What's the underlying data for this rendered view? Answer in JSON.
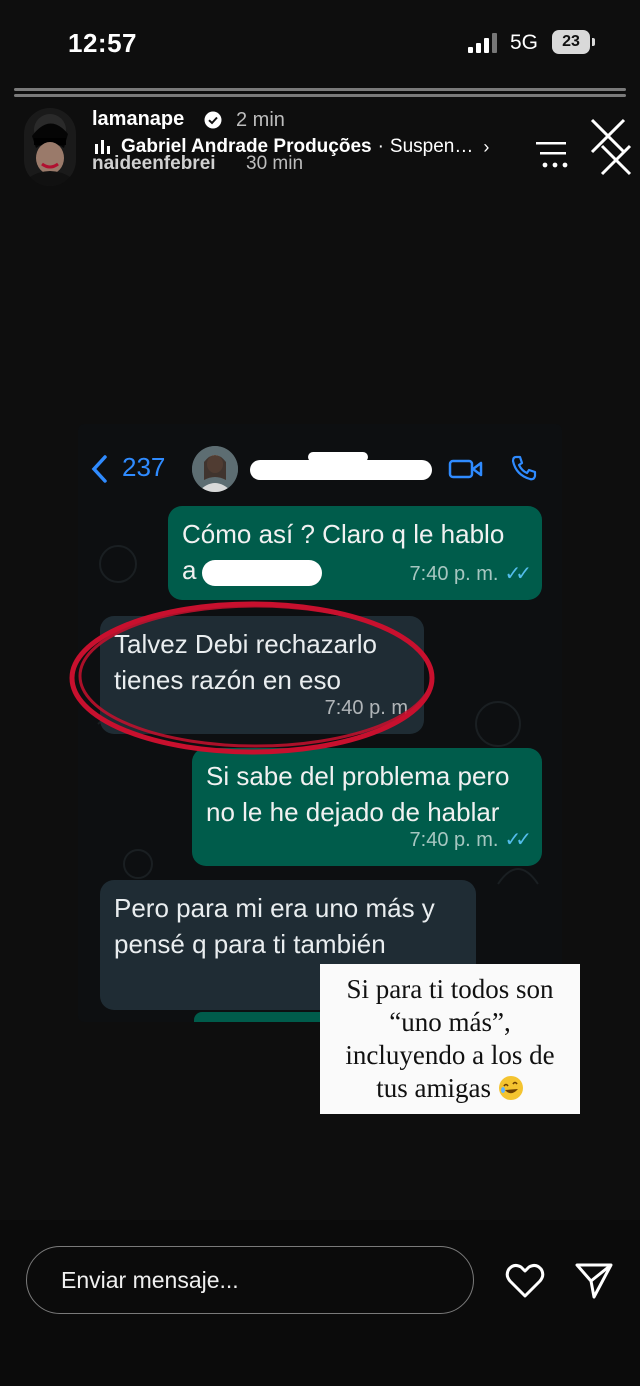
{
  "status_bar": {
    "time": "12:57",
    "network": "5G",
    "battery": "23"
  },
  "story_header": {
    "username": "lamanape",
    "time_ago": "2 min",
    "music": {
      "title": "Gabriel Andrade Produções",
      "separator": "·",
      "subtitle": "Suspen…",
      "chevron": "›"
    },
    "username_2": "naideenfebrei",
    "time_ago_2": "30 min",
    "more_icon": "ellipsis-icon",
    "close_icon": "close-icon"
  },
  "chat_screenshot": {
    "back_count": "237",
    "messages": [
      {
        "direction": "out",
        "text_line1": "Cómo así ? Claro q le hablo",
        "text_line2": "a",
        "time": "7:40 p. m.",
        "ticks": "✓✓"
      },
      {
        "direction": "in",
        "text_line1": "Talvez Debi rechazarlo",
        "text_line2": "tienes razón en eso",
        "time": "7:40 p. m"
      },
      {
        "direction": "out",
        "text_line1": "Si sabe del problema pero",
        "text_line2": "no le he dejado de hablar",
        "time": "7:40 p. m.",
        "ticks": "✓✓"
      },
      {
        "direction": "in",
        "text_line1": "Pero para mi era uno más y",
        "text_line2": "pensé q para ti también"
      }
    ]
  },
  "sticker_text": {
    "line1": "Si para ti todos son",
    "line2": "“uno más”,",
    "line3": "incluyendo a los de",
    "line4": "tus amigas",
    "emoji": "laughing-emoji"
  },
  "composer": {
    "placeholder": "Enviar mensaje...",
    "heart_icon": "heart-icon",
    "send_icon": "send-icon"
  },
  "colors": {
    "outgoing_bubble": "#005c4b",
    "incoming_bubble": "#1f2c34",
    "accent_blue": "#2f8bff",
    "annotation_red": "#c8102e"
  }
}
